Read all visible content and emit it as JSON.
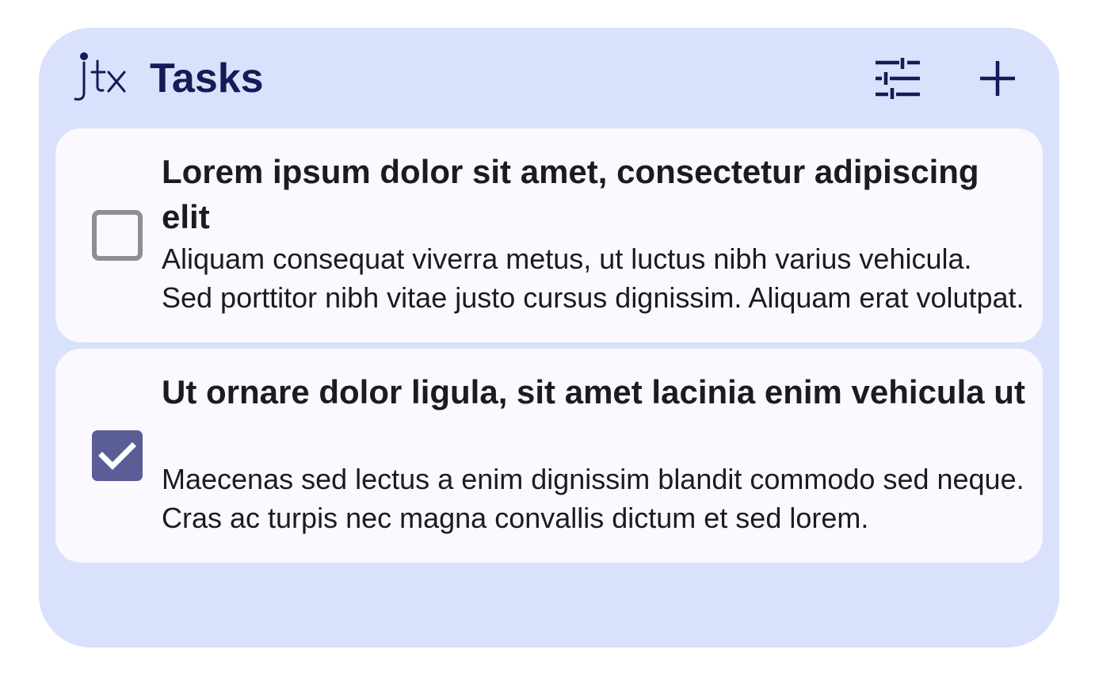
{
  "app": {
    "logo_text": "jtx",
    "title": "Tasks"
  },
  "header": {
    "filter_icon": "tune-sliders-icon",
    "add_icon": "plus-icon"
  },
  "colors": {
    "widget_background": "#d9e1fd",
    "card_background": "#fbf8fe",
    "title_color": "#141b55",
    "checkbox_checked": "#5a5d96",
    "checkbox_unchecked_border": "#8e8e94"
  },
  "tasks": [
    {
      "title": "Lorem ipsum dolor sit amet, consectetur adipiscing elit",
      "description": "Aliquam consequat viverra metus, ut luctus nibh varius vehicula. Sed porttitor nibh vitae justo cursus dignissim. Aliquam erat volutpat.",
      "checked": false
    },
    {
      "title": "Ut ornare dolor ligula, sit amet lacinia enim vehicula ut",
      "description": "Maecenas sed lectus a enim dignissim blandit commodo sed neque. Cras ac turpis nec magna convallis dictum et sed lorem.",
      "checked": true
    }
  ]
}
